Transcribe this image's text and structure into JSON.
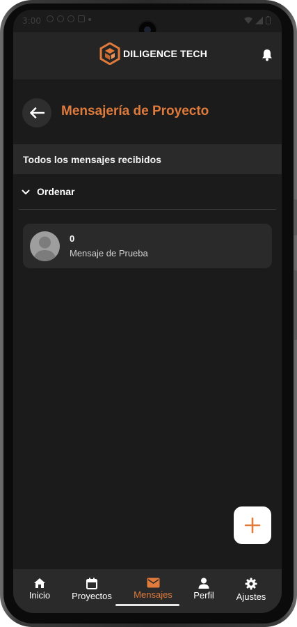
{
  "status_bar": {
    "time": "3:00"
  },
  "header": {
    "brand": "DILIGENCE TECH",
    "logo_icon": "cube-logo-icon",
    "notification_icon": "bell-icon"
  },
  "page": {
    "title": "Mensajería de Proyecto",
    "back_icon": "arrow-left-icon",
    "section_title": "Todos los mensajes recibidos",
    "sort_label": "Ordenar"
  },
  "messages": [
    {
      "sender": "0",
      "text": "Mensaje de Prueba",
      "avatar_icon": "person-avatar-icon"
    }
  ],
  "fab": {
    "icon": "plus-icon"
  },
  "nav": {
    "items": [
      {
        "label": "Inicio",
        "icon": "home-icon",
        "active": false
      },
      {
        "label": "Proyectos",
        "icon": "calendar-icon",
        "active": false
      },
      {
        "label": "Mensajes",
        "icon": "mail-icon",
        "active": true
      },
      {
        "label": "Perfil",
        "icon": "person-icon",
        "active": false
      },
      {
        "label": "Ajustes",
        "icon": "gear-icon",
        "active": false
      }
    ]
  },
  "colors": {
    "accent": "#e07b3c",
    "background": "#1b1b1b",
    "surface": "#2a2a2a",
    "header": "#252525"
  }
}
